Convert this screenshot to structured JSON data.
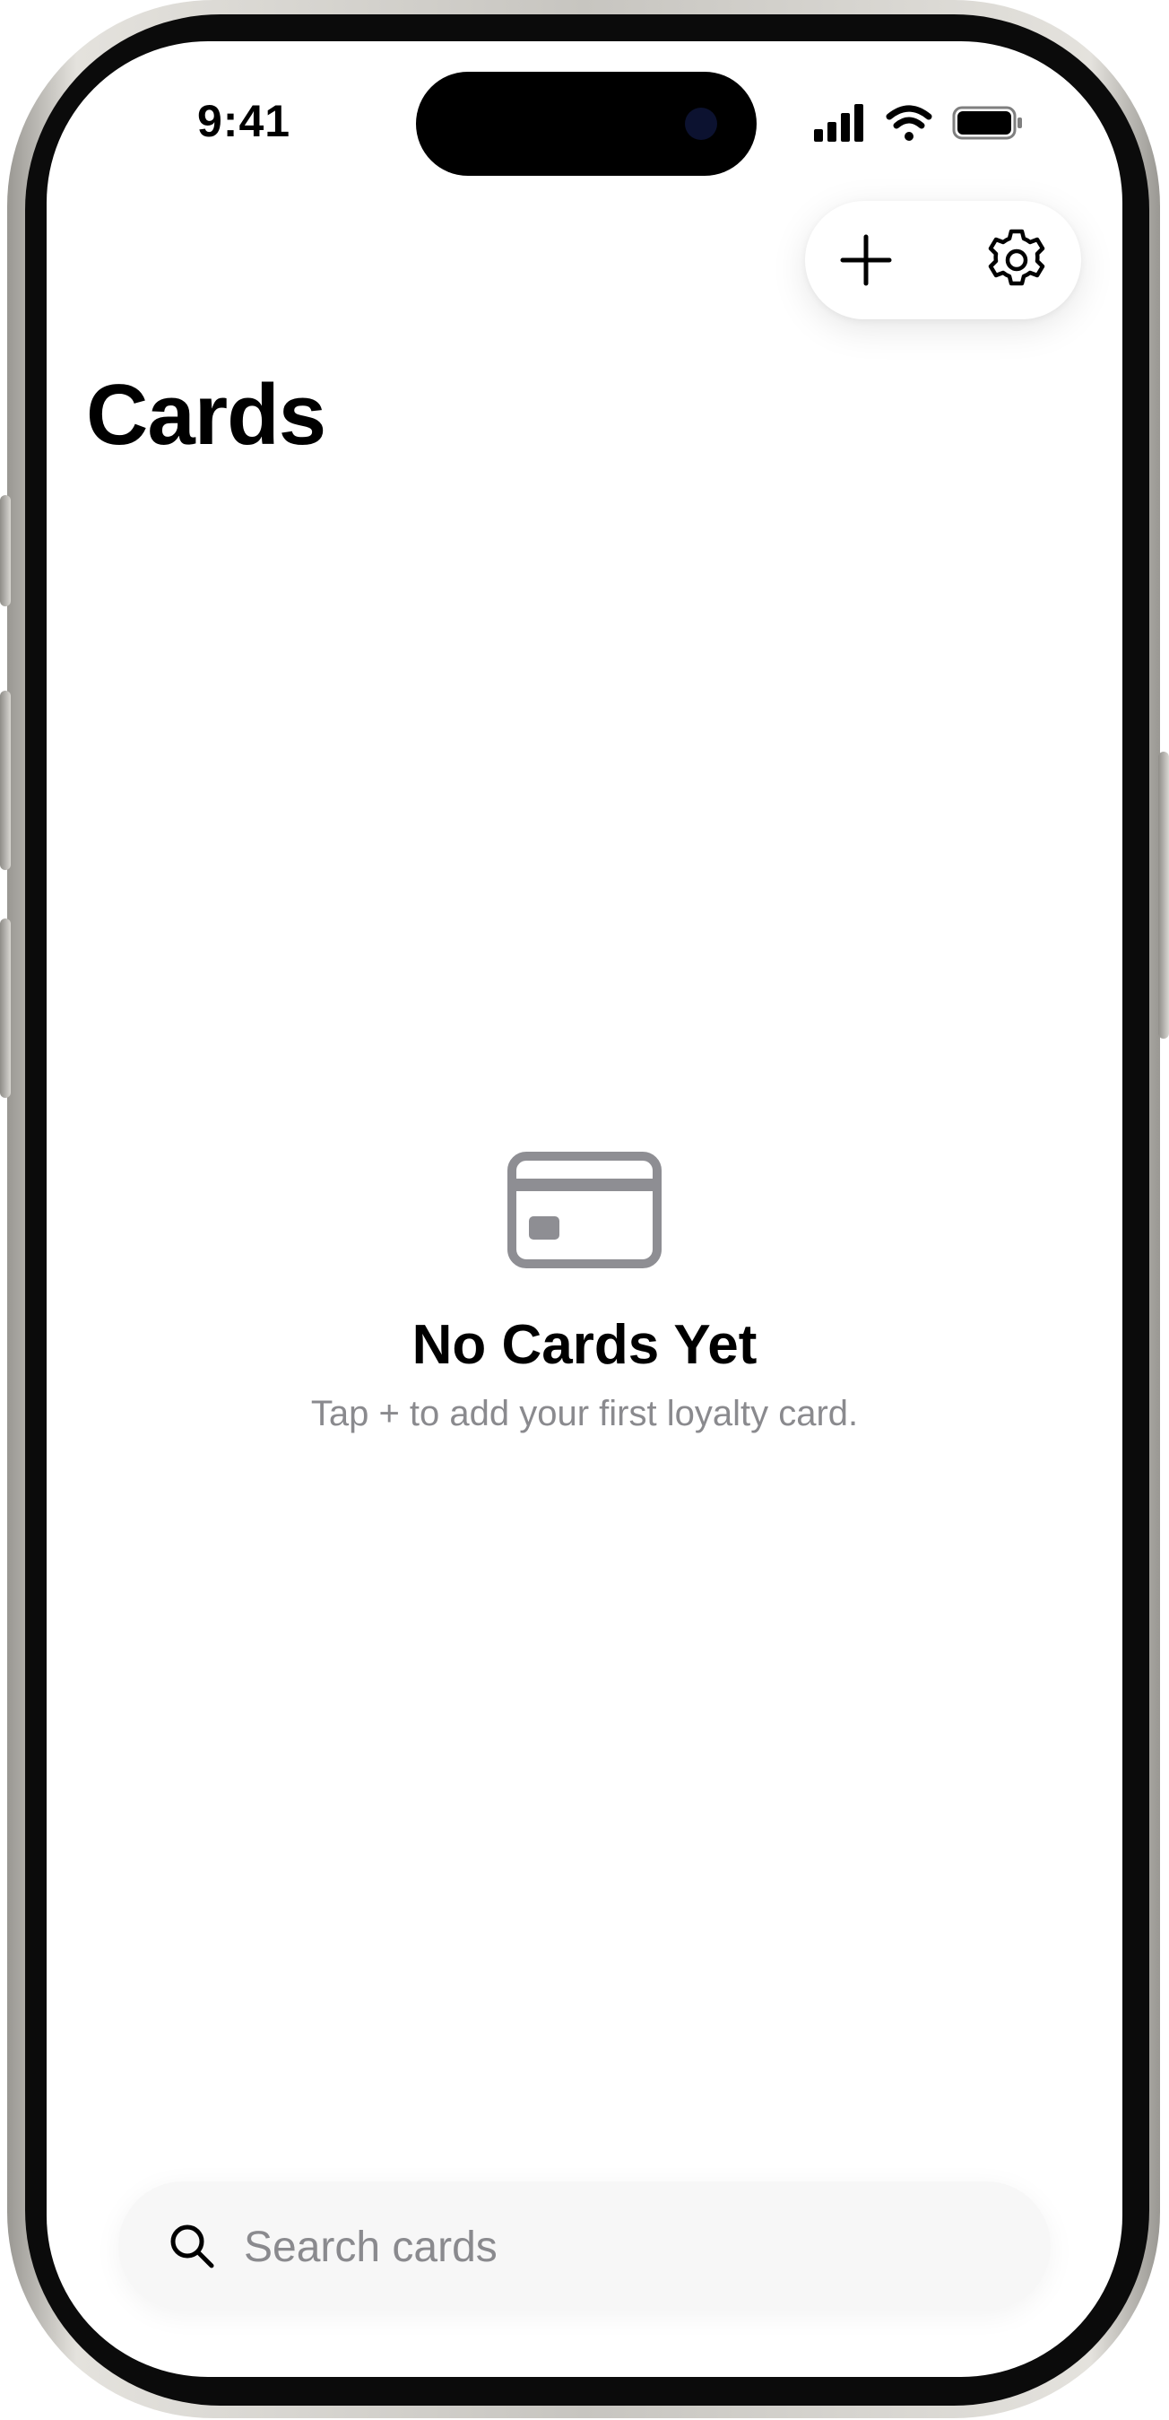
{
  "status_bar": {
    "time": "9:41",
    "icons": [
      "cellular-signal-icon",
      "wifi-icon",
      "battery-icon"
    ]
  },
  "toolbar": {
    "add_icon": "plus-icon",
    "settings_icon": "gear-icon"
  },
  "page": {
    "title": "Cards"
  },
  "empty_state": {
    "icon": "credit-card-icon",
    "title": "No Cards Yet",
    "subtitle": "Tap + to add your first loyalty card."
  },
  "search": {
    "icon": "search-icon",
    "placeholder": "Search cards",
    "value": ""
  },
  "colors": {
    "background": "#ffffff",
    "text_primary": "#000000",
    "text_secondary": "#8a8a8e",
    "icon_gray": "#8e8e93",
    "search_bg": "#f7f7f7"
  }
}
